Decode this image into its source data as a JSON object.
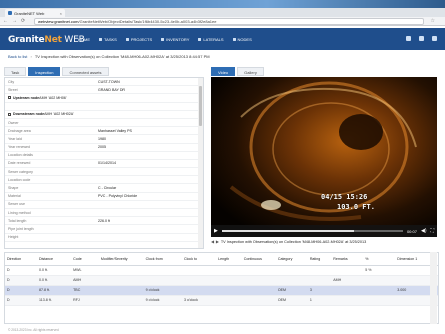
{
  "browser": {
    "tab_title": "GraniteNET Web",
    "tab_close": "×",
    "window_controls": [
      "—",
      "☐",
      "✕"
    ],
    "back": "←",
    "forward": "→",
    "reload": "⟳",
    "url_host": "webview.granitnet.com",
    "url_path": "/GraniteNetWeb/ObjectDetails/Task/1f6b4430-5c23-4e0b-a003-a4b3f2e8a1ee",
    "star": "☆"
  },
  "app": {
    "logo_prefix": "Granite",
    "logo_accent": "Net",
    "logo_suffix": " WEB",
    "nav": [
      "HOME",
      "Tasks",
      "Projects",
      "Inventory",
      "Laterals",
      "Nodes"
    ]
  },
  "breadcrumb": {
    "back": "Back to list",
    "path": "TV Inspection with Observation(s) on Collection 'M48-MH06-A02-MH02A' at 3/25/2013 8:44:57 PM"
  },
  "left_tabs": [
    "Task",
    "Inspection",
    "Connected assets"
  ],
  "right_tabs": [
    "Video",
    "Gallery"
  ],
  "fields": [
    {
      "label": "City",
      "value": "CUST-TOWN"
    },
    {
      "label": "Street",
      "value": "GRAND BAY DR"
    },
    {
      "label": "Upstream node",
      "value": "AMH 'A02 MH06'",
      "header": true
    },
    {
      "label": "",
      "value": ""
    },
    {
      "label": "Downstream node",
      "value": "AMH 'A02 MH02A'",
      "header": true
    },
    {
      "label": "Owner",
      "value": ""
    },
    {
      "label": "Drainage area",
      "value": "Manhasset Valley PS"
    },
    {
      "label": "Year laid",
      "value": "1980"
    },
    {
      "label": "Year renewed",
      "value": "2005"
    },
    {
      "label": "Location details",
      "value": ""
    },
    {
      "label": "Date renewed",
      "value": "01/14/2014"
    },
    {
      "label": "Sewer category",
      "value": ""
    },
    {
      "label": "Location code",
      "value": ""
    },
    {
      "label": "Shape",
      "value": "C - Circular"
    },
    {
      "label": "Material",
      "value": "PVC - Polyvinyl Chloride"
    },
    {
      "label": "Sewer use",
      "value": ""
    },
    {
      "label": "Lining method",
      "value": ""
    },
    {
      "label": "Total length",
      "value": "226.0 ft"
    },
    {
      "label": "Pipe joint length",
      "value": ""
    },
    {
      "label": "Height",
      "value": ""
    }
  ],
  "video": {
    "date": "04/15 15:26",
    "distance": "103.0 FT.",
    "play": "▶",
    "volume": "◀)",
    "time": "00:07",
    "fullscreen": "⛶",
    "progress": 0.73,
    "caption": "TV Inspection with Observation(s) on Collection 'M48-MH06-A02-MH02A' at 3/25/2013"
  },
  "grid": {
    "columns": [
      "Direction",
      "Distance",
      "Code",
      "Modifier/Severity",
      "Clock from",
      "Clock to",
      "Length",
      "Continuous",
      "Category",
      "Rating",
      "Remarks",
      "%",
      "Dimension 1"
    ],
    "rows": [
      [
        "D",
        "0.0 ft.",
        "MWL",
        "",
        "",
        "",
        "",
        "",
        "",
        "",
        "",
        "5 %",
        ""
      ],
      [
        "D",
        "0.0 ft.",
        "AMH",
        "",
        "",
        "",
        "",
        "",
        "",
        "",
        "AMH",
        "",
        ""
      ],
      [
        "D",
        "87.8 ft.",
        "TBC",
        "",
        "9 o'clock",
        "",
        "",
        "",
        "OEM",
        "3",
        "",
        "",
        "3.000"
      ],
      [
        "D",
        "113.8 ft.",
        "RFJ",
        "",
        "9 o'clock",
        "3 o'clock",
        "",
        "",
        "OEM",
        "1",
        "",
        "",
        ""
      ]
    ],
    "selected_row": 2
  },
  "footer": "© 2013-2023 Inc. All rights reserved"
}
